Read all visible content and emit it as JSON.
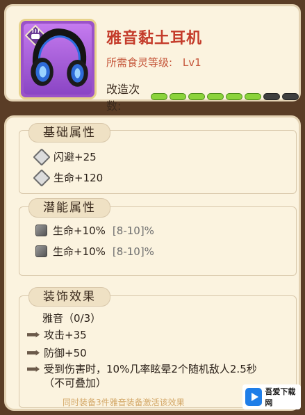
{
  "item": {
    "name": "雅音黏土耳机",
    "req_label": "所需食灵等级:",
    "req_value": "Lv1",
    "mod_label": "改造次数:",
    "mod_progress": {
      "filled": 6,
      "total": 8
    },
    "badge_icon": "cup-badge-icon",
    "image_icon": "headphones-icon"
  },
  "basic": {
    "title": "基础属性",
    "stats": [
      "闪避+25",
      "生命+120"
    ]
  },
  "potential": {
    "title": "潜能属性",
    "stats": [
      {
        "label": "生命+10%",
        "range": "[8-10]%"
      },
      {
        "label": "生命+10%",
        "range": "[8-10]%"
      }
    ]
  },
  "decor": {
    "title": "装饰效果",
    "set_name": "雅音（0/3）",
    "effects": [
      "攻击+35",
      "防御+50",
      "受到伤害时，10%几率眩晕2个随机敌人2.5秒（不可叠加）"
    ],
    "footer": "同时装备3件雅音装备激活该效果"
  },
  "watermark": {
    "text": "吾爱下载网"
  },
  "colors": {
    "title_red": "#c43b2a",
    "progress_green": "#8bd33b",
    "item_purple": "#9a52c9"
  }
}
